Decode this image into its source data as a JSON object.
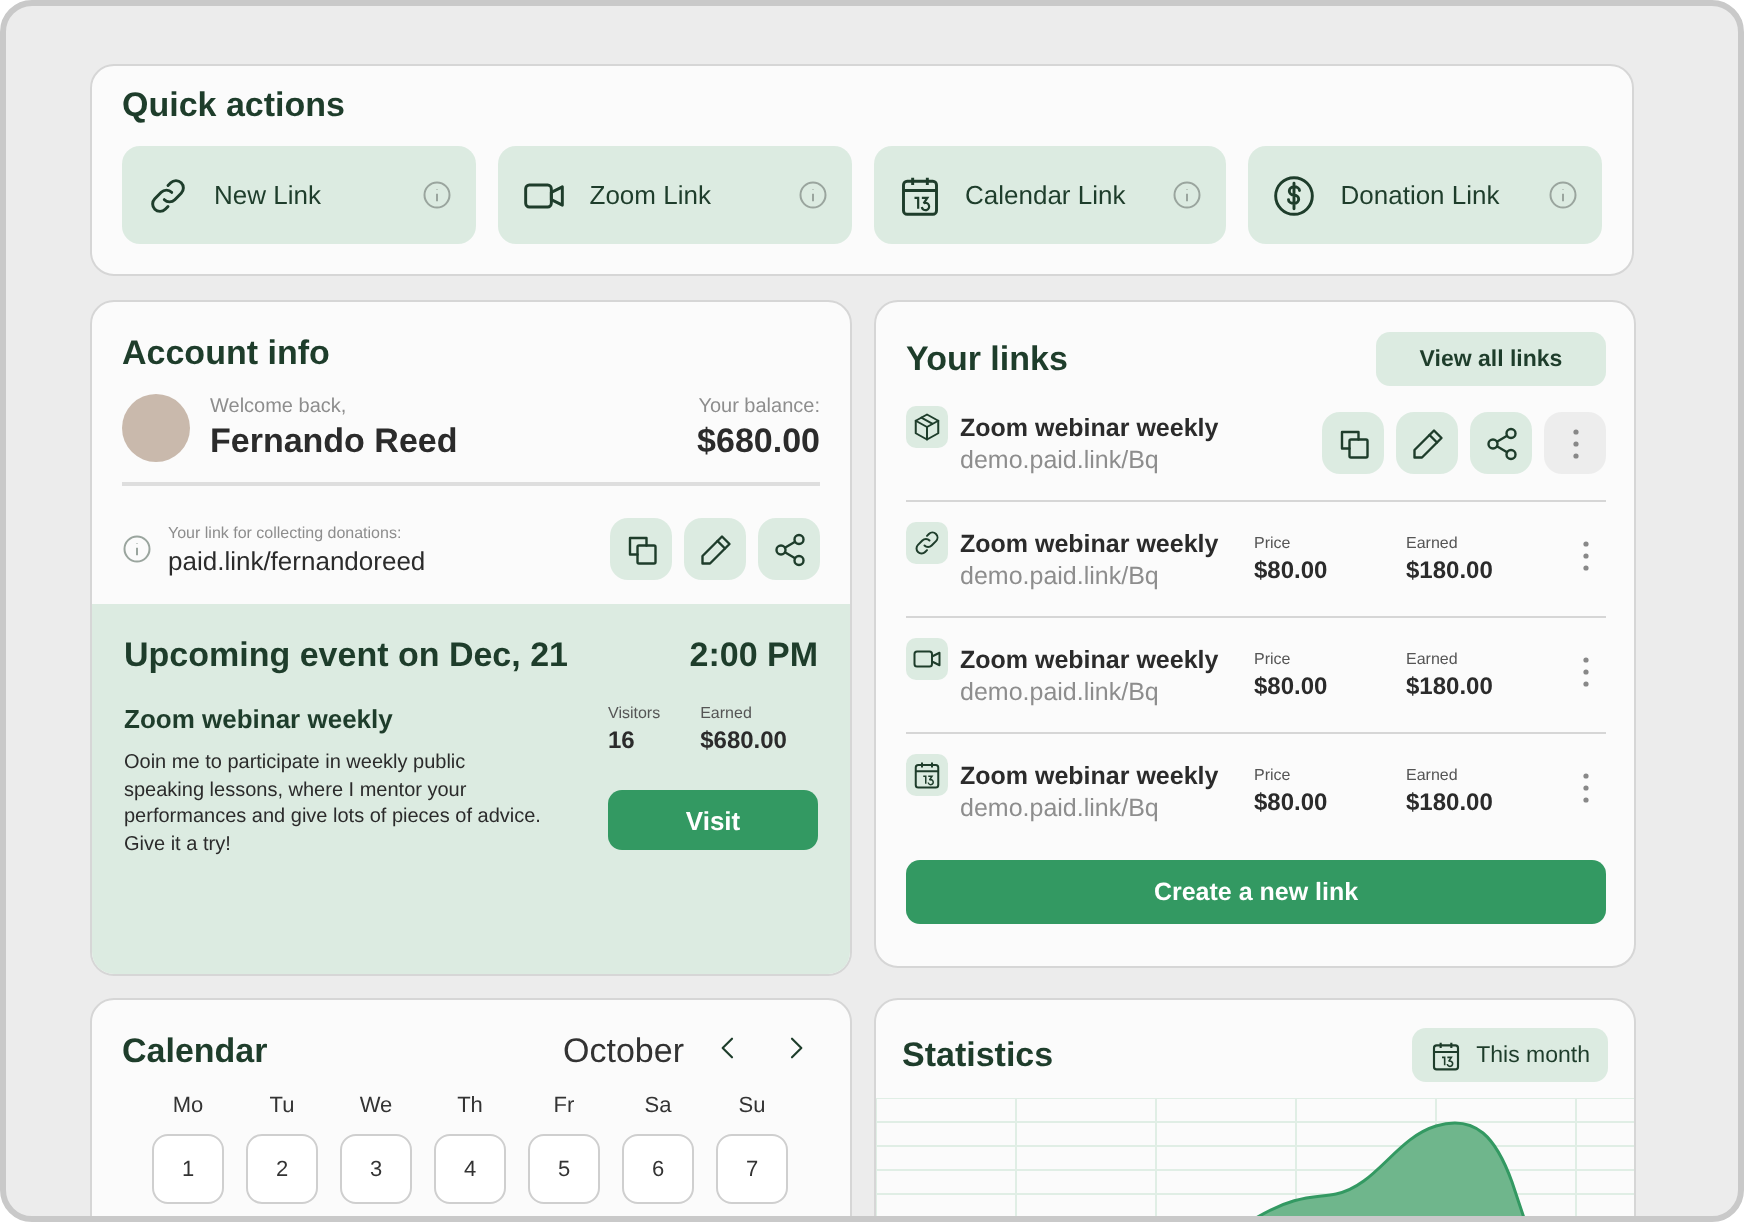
{
  "quick_actions": {
    "title": "Quick actions",
    "items": [
      {
        "label": "New Link"
      },
      {
        "label": "Zoom Link"
      },
      {
        "label": "Calendar Link"
      },
      {
        "label": "Donation Link"
      }
    ]
  },
  "account": {
    "title": "Account info",
    "welcome": "Welcome back,",
    "name": "Fernando Reed",
    "balance_label": "Your balance:",
    "balance": "$680.00",
    "donation_label": "Your link for collecting donations:",
    "donation_link": "paid.link/fernandoreed",
    "event": {
      "heading": "Upcoming event on Dec, 21",
      "time": "2:00 PM",
      "name": "Zoom webinar weekly",
      "description": "Ooin me to participate in weekly public speaking lessons, where I mentor your performances and give lots of pieces of advice. Give it a try!",
      "visitors_label": "Visitors",
      "visitors": "16",
      "earned_label": "Earned",
      "earned": "$680.00",
      "button": "Visit"
    }
  },
  "links": {
    "title": "Your links",
    "view_all": "View all links",
    "create": "Create a new link",
    "items": [
      {
        "kind": "actions",
        "title": "Zoom webinar weekly",
        "url": "demo.paid.link/Bq"
      },
      {
        "kind": "stats",
        "title": "Zoom webinar weekly",
        "url": "demo.paid.link/Bq",
        "price_label": "Price",
        "price": "$80.00",
        "earned_label": "Earned",
        "earned": "$180.00"
      },
      {
        "kind": "stats",
        "title": "Zoom webinar weekly",
        "url": "demo.paid.link/Bq",
        "price_label": "Price",
        "price": "$80.00",
        "earned_label": "Earned",
        "earned": "$180.00"
      },
      {
        "kind": "stats",
        "title": "Zoom webinar weekly",
        "url": "demo.paid.link/Bq",
        "price_label": "Price",
        "price": "$80.00",
        "earned_label": "Earned",
        "earned": "$180.00"
      }
    ]
  },
  "calendar": {
    "title": "Calendar",
    "month": "October",
    "weekdays": [
      "Mo",
      "Tu",
      "We",
      "Th",
      "Fr",
      "Sa",
      "Su"
    ],
    "days": [
      "1",
      "2",
      "3",
      "4",
      "5",
      "6",
      "7"
    ]
  },
  "statistics": {
    "title": "Statistics",
    "period": "This month"
  }
}
